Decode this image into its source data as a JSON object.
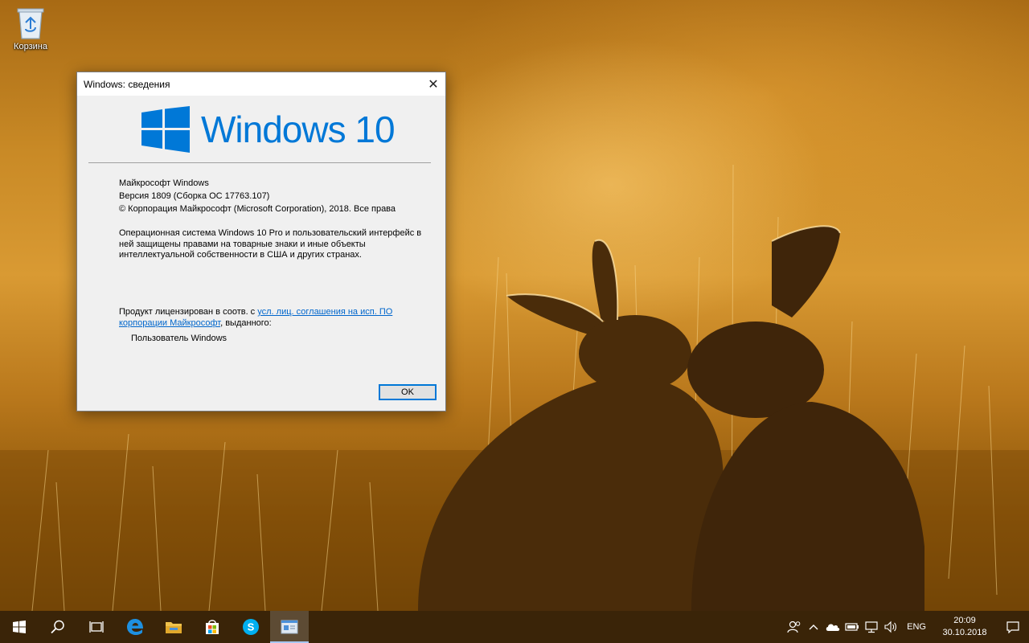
{
  "desktop": {
    "recycle_bin_label": "Корзина"
  },
  "dialog": {
    "title": "Windows: сведения",
    "logo_text": "Windows 10",
    "product_name": "Майкрософт Windows",
    "version": "Версия 1809 (Сборка ОС 17763.107)",
    "copyright": "© Корпорация Майкрософт (Microsoft Corporation), 2018. Все права",
    "description": "Операционная система Windows 10 Pro и пользовательский интерфейс в ней защищены правами на товарные знаки и иные объекты интеллектуальной собственности в США и других странах.",
    "license_prefix": "Продукт лицензирован в соотв. с ",
    "license_link": "усл. лиц. соглашения на исп. ПО корпорации Майкрософт",
    "license_suffix": ", выданного:",
    "licensed_user": "Пользователь Windows",
    "ok_label": "OK"
  },
  "taskbar": {
    "items": [
      {
        "name": "start-button",
        "icon": "windows-logo-icon"
      },
      {
        "name": "search-button",
        "icon": "search-icon"
      },
      {
        "name": "task-view-button",
        "icon": "task-view-icon"
      },
      {
        "name": "edge-button",
        "icon": "edge-icon"
      },
      {
        "name": "file-explorer-button",
        "icon": "folder-icon"
      },
      {
        "name": "store-button",
        "icon": "store-icon"
      },
      {
        "name": "skype-button",
        "icon": "skype-icon"
      },
      {
        "name": "winver-button",
        "icon": "winver-window-icon",
        "active": true
      }
    ],
    "language": "ENG",
    "time": "20:09",
    "date": "30.10.2018"
  },
  "colors": {
    "accent": "#0078d7",
    "link": "#0066cc",
    "taskbar": "#3a2408"
  }
}
